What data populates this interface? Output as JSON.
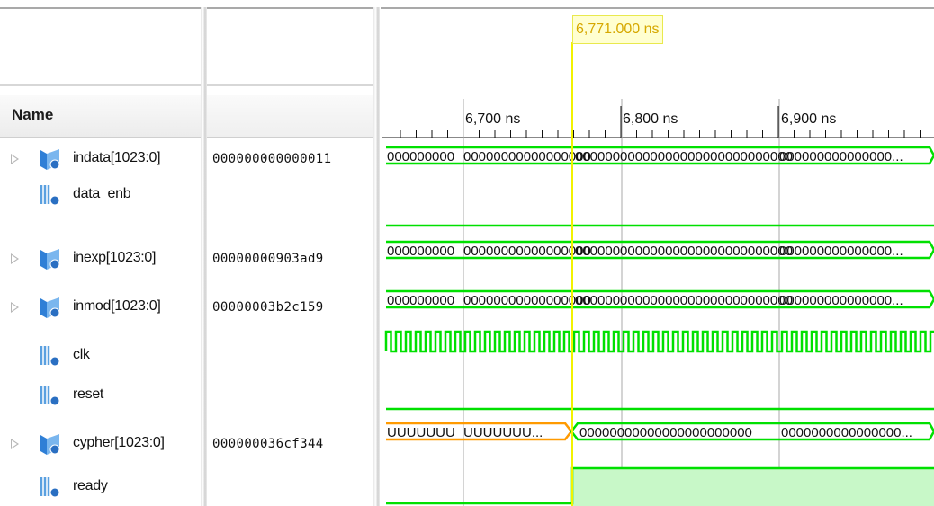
{
  "header": {
    "name_column": "Name"
  },
  "cursor": {
    "time_label": "6,771.000 ns"
  },
  "ruler": {
    "labels": [
      "6,700 ns",
      "6,800 ns",
      "6,900 ns"
    ]
  },
  "signals": [
    {
      "name": "indata[1023:0]",
      "type": "bus",
      "value": "000000000000011",
      "wave": {
        "seg1": "000000000",
        "seg2": "00000000000000000",
        "seg3": "00000000000000000000000000000",
        "seg4": "000000000000000..."
      }
    },
    {
      "name": "data_enb",
      "type": "bit",
      "value": ""
    },
    {
      "name": "inexp[1023:0]",
      "type": "bus",
      "value": "00000000903ad9",
      "wave": {
        "seg1": "000000000",
        "seg2": "00000000000000000",
        "seg3": "00000000000000000000000000000",
        "seg4": "000000000000000..."
      }
    },
    {
      "name": "inmod[1023:0]",
      "type": "bus",
      "value": "00000003b2c159",
      "wave": {
        "seg1": "000000000",
        "seg2": "00000000000000000",
        "seg3": "00000000000000000000000000000",
        "seg4": "000000000000000..."
      }
    },
    {
      "name": "clk",
      "type": "bit",
      "value": ""
    },
    {
      "name": "reset",
      "type": "bit",
      "value": ""
    },
    {
      "name": "cypher[1023:0]",
      "type": "bus",
      "value": "000000036cf344",
      "wave": {
        "seg1": "UUUUUUU",
        "seg2": "UUUUUUU...",
        "seg3": "00000000000000000000000",
        "seg4": "0000000000000000..."
      }
    },
    {
      "name": "ready",
      "type": "bit",
      "value": ""
    }
  ],
  "colors": {
    "wave_green": "#00e000",
    "undefined_orange": "#ff9a00",
    "cursor_yellow": "#f2f200",
    "ready_fill": "#c8f8c8",
    "bus_icon": "#2f7fd6",
    "bit_icon": "#5aa0e0"
  }
}
